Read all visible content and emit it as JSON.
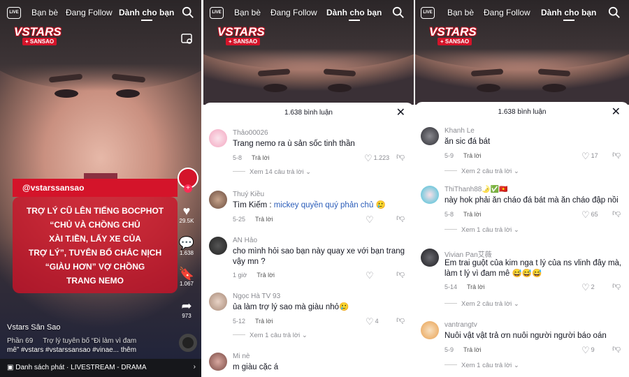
{
  "nav": {
    "live": "LIVE",
    "friends": "Bạn bè",
    "following": "Đang Follow",
    "foryou": "Dành cho bạn"
  },
  "brand": {
    "line1": "VSTARS",
    "line2": "+ SANSAO"
  },
  "video": {
    "handle": "@vstarssansao",
    "caption": [
      "TRỢ LÝ CŨ LÊN TIẾNG BOCPHOT",
      "“CHỦ VÀ CHỒNG CHỦ",
      "XÀI T.IỀN, LẤY XE CỦA",
      "TRỢ LÝ”, TUYÊN BỐ CHẮC NỊCH",
      "“GIÀU HƠN” VỢ CHỒNG",
      "TRANG NEMO"
    ],
    "likes": "29.5K",
    "comments": "1.638",
    "saves": "1.067",
    "shares": "973",
    "author": "Vstars Sân Sao",
    "part": "Phần 69",
    "desc_line1": "Trợ lý tuyên bố “Đi làm vì đam",
    "desc_line2": "mê” #vstars #vstarssansao #vinae... thêm",
    "playlist": "Danh sách phát · LIVESTREAM - DRAMA"
  },
  "sheet_title": "1.638 bình luận",
  "reply_label": "Trả lời",
  "panel2_comments": [
    {
      "name": "Thảo00026",
      "text": "Trang nemo ra ù sản sốc tinh thần",
      "time": "5-8",
      "likes": "1.223",
      "more": "Xem 14 câu trả lời"
    },
    {
      "name": "Thuý Kiều",
      "text_pre": "Tìm Kiếm : ",
      "text_link": "mickey quyền quý phản chủ",
      "text_post": " 🥲",
      "time": "5-25",
      "likes": "",
      "more": ""
    },
    {
      "name": "AN Hảo",
      "text": "cho mình hỏi sao bạn này quay xe với bạn trang vậy mn ?",
      "time": "1 giờ",
      "likes": "",
      "more": ""
    },
    {
      "name": "Ngọc Hà TV 93",
      "text": "ủa làm trợ lý sao mà giàu nhỏ🥲",
      "time": "5-12",
      "likes": "4",
      "more": "Xem 1 câu trả lời"
    },
    {
      "name": "Mi nè",
      "text": "m giàu cặc á",
      "time": "",
      "likes": "",
      "more": ""
    }
  ],
  "panel3_comments": [
    {
      "name": "Khanh Le",
      "text": "ăn sic đá bát",
      "time": "5-9",
      "likes": "17",
      "more": "Xem 2 câu trả lời"
    },
    {
      "name": "ThiThanh88🌛✅🇻🇳",
      "text": "này hok phải ăn cháo đá bát mà ăn cháo đập nồi",
      "time": "5-8",
      "likes": "65",
      "more": "Xem 1 câu trả lời"
    },
    {
      "name": "Vivian Pan艾薇",
      "text": "Em trai guột của kim nga t lý của ns vlinh đây mà, làm t lý vì đam mê 😅😅😅",
      "time": "5-14",
      "likes": "2",
      "more": "Xem 2 câu trả lời"
    },
    {
      "name": "vantrangtv",
      "text": "Nuôi vật vật trả ơn nuôi người người báo oán",
      "time": "5-9",
      "likes": "9",
      "more": "Xem 1 câu trả lời"
    }
  ]
}
